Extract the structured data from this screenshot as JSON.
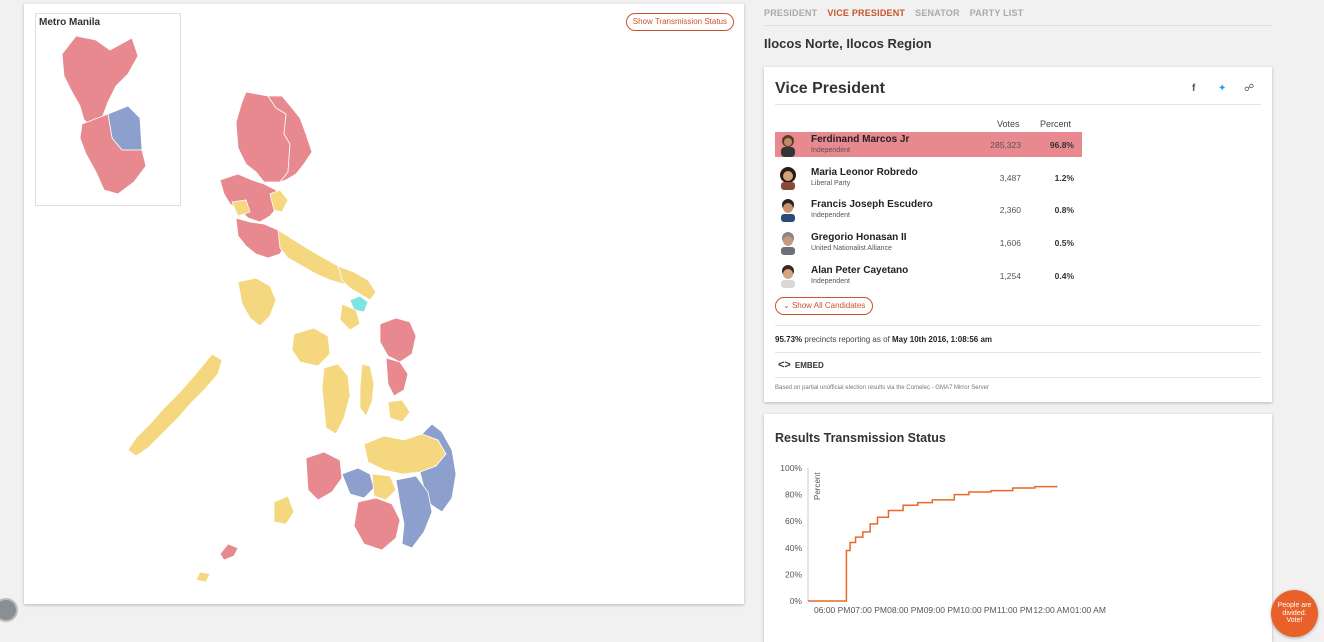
{
  "map": {
    "inset_title": "Metro Manila",
    "transmission_button": "Show Transmission Status",
    "colors": {
      "marcos": "#e8898f",
      "robredo": "#f4d77f",
      "escudero": "#8d9fcc",
      "other": "#7de3e3",
      "border": "#ffffff"
    }
  },
  "tabs": [
    {
      "label": "PRESIDENT",
      "active": false
    },
    {
      "label": "VICE PRESIDENT",
      "active": true
    },
    {
      "label": "SENATOR",
      "active": false
    },
    {
      "label": "PARTY LIST",
      "active": false
    }
  ],
  "region_title": "Ilocos Norte, Ilocos Region",
  "vp_card": {
    "title": "Vice President",
    "share_icons": [
      "facebook-icon",
      "twitter-icon",
      "share-icon"
    ],
    "col_votes": "Votes",
    "col_percent": "Percent",
    "candidates": [
      {
        "name": "Ferdinand Marcos Jr",
        "party": "Independent",
        "votes": "285,323",
        "percent": "96.8%",
        "leader": true
      },
      {
        "name": "Maria Leonor Robredo",
        "party": "Liberal Party",
        "votes": "3,487",
        "percent": "1.2%",
        "leader": false
      },
      {
        "name": "Francis Joseph Escudero",
        "party": "Independent",
        "votes": "2,360",
        "percent": "0.8%",
        "leader": false
      },
      {
        "name": "Gregorio Honasan II",
        "party": "United Nationalist Alliance",
        "votes": "1,606",
        "percent": "0.5%",
        "leader": false
      },
      {
        "name": "Alan Peter Cayetano",
        "party": "Independent",
        "votes": "1,254",
        "percent": "0.4%",
        "leader": false
      }
    ],
    "show_all": "Show All Candidates",
    "precincts_pct": "95.73%",
    "precincts_text": " precincts reporting as of ",
    "precincts_time": "May 10th 2016, 1:08:56 am",
    "embed": "EMBED",
    "source": "Based on partial unofficial election results via the Comelec - GMA7 Mirror Server"
  },
  "transmission": {
    "title": "Results Transmission Status"
  },
  "fab": {
    "line1": "People are",
    "line2": "divided.",
    "line3": "Vote!"
  },
  "chart_data": {
    "type": "line",
    "title": "Results Transmission Status",
    "ylabel": "Percent",
    "xlabel": "",
    "ylim": [
      0,
      100
    ],
    "y_ticks": [
      "0%",
      "20%",
      "40%",
      "60%",
      "80%",
      "100%"
    ],
    "x_ticks": [
      "06:00 PM",
      "07:00 PM",
      "08:00 PM",
      "09:00 PM",
      "10:00 PM",
      "11:00 PM",
      "12:00 AM",
      "01:00 AM"
    ],
    "color": "#e8692a",
    "series": [
      {
        "x": [
          0,
          0.9,
          1.05,
          1.15,
          1.3,
          1.5,
          1.7,
          1.9,
          2.2,
          2.6,
          3.0,
          3.4,
          4.0,
          4.4,
          5.0,
          5.6,
          6.2,
          6.8
        ],
        "y": [
          0,
          0,
          38,
          44,
          48,
          52,
          58,
          63,
          68,
          72,
          74,
          76,
          80,
          82,
          83,
          85,
          86,
          86.7
        ]
      }
    ]
  }
}
